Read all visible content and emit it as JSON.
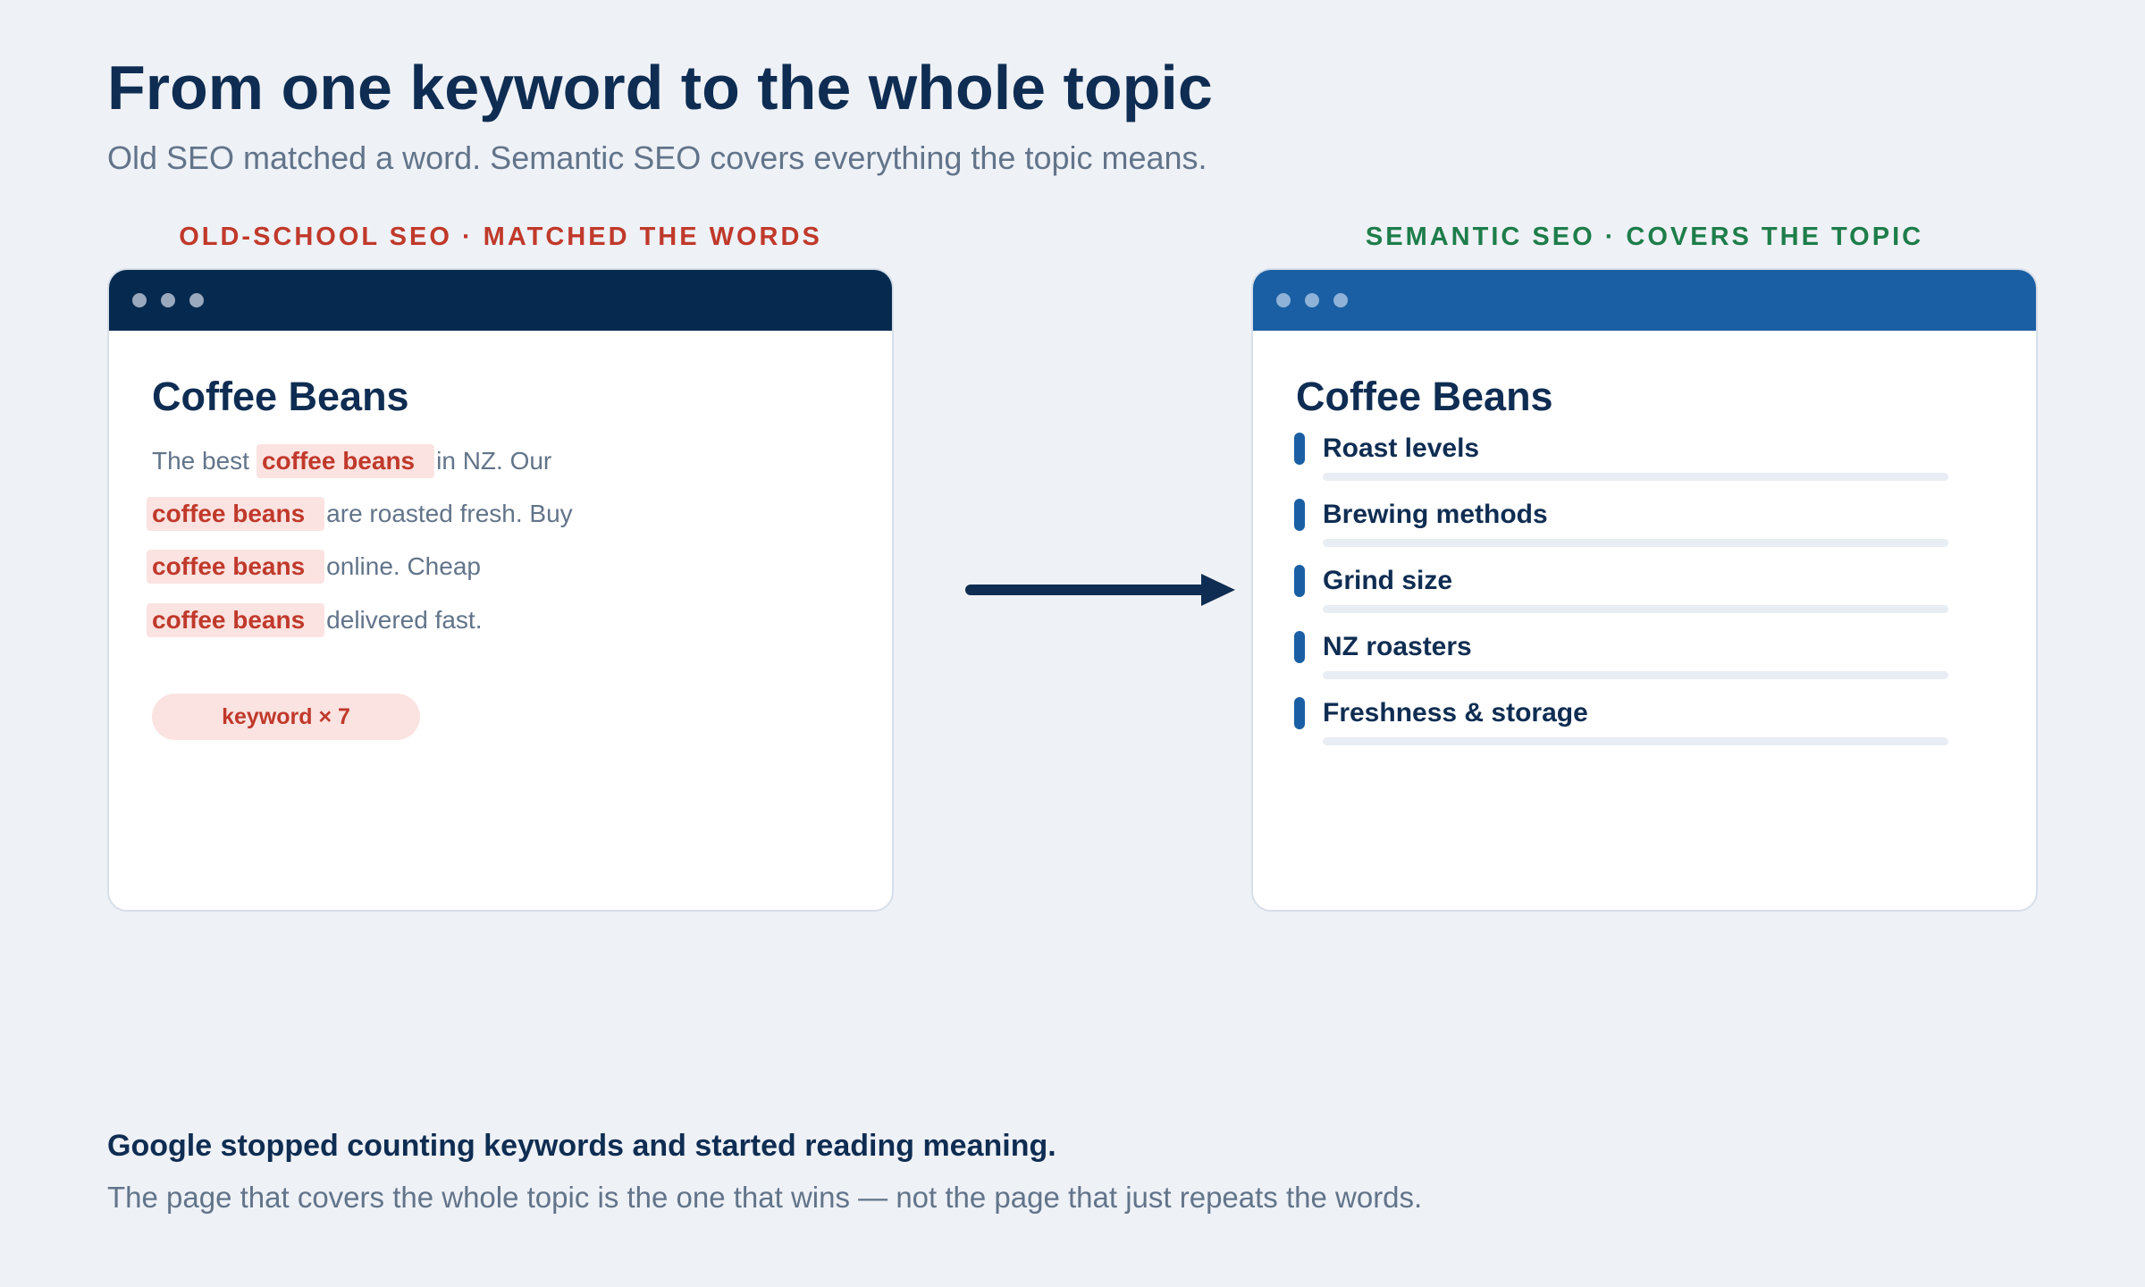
{
  "header": {
    "title": "From one keyword to the whole topic",
    "subtitle": "Old SEO matched a word. Semantic SEO covers everything the topic means."
  },
  "old_panel": {
    "label": "OLD-SCHOOL SEO · MATCHED THE WORDS",
    "page_heading": "Coffee Beans",
    "lines": [
      {
        "before": "The best",
        "keyword": "coffee beans",
        "after": "in NZ. Our"
      },
      {
        "before": "",
        "keyword": "coffee beans",
        "after": "are roasted fresh. Buy"
      },
      {
        "before": "",
        "keyword": "coffee beans",
        "after": "online. Cheap"
      },
      {
        "before": "",
        "keyword": "coffee beans",
        "after": "delivered fast."
      }
    ],
    "badge": "keyword × 7",
    "accent_color": "#c0392b",
    "titlebar_color": "#062a4f"
  },
  "new_panel": {
    "label": "SEMANTIC SEO · COVERS THE TOPIC",
    "page_heading": "Coffee Beans",
    "topics": [
      "Roast levels",
      "Brewing methods",
      "Grind size",
      "NZ roasters",
      "Freshness & storage"
    ],
    "accent_color": "#1e7d4a",
    "titlebar_color": "#1a5fa3"
  },
  "footer": {
    "title": "Google stopped counting keywords and started reading meaning.",
    "text": "The page that covers the whole topic is the one that wins — not the page that just repeats the words."
  }
}
